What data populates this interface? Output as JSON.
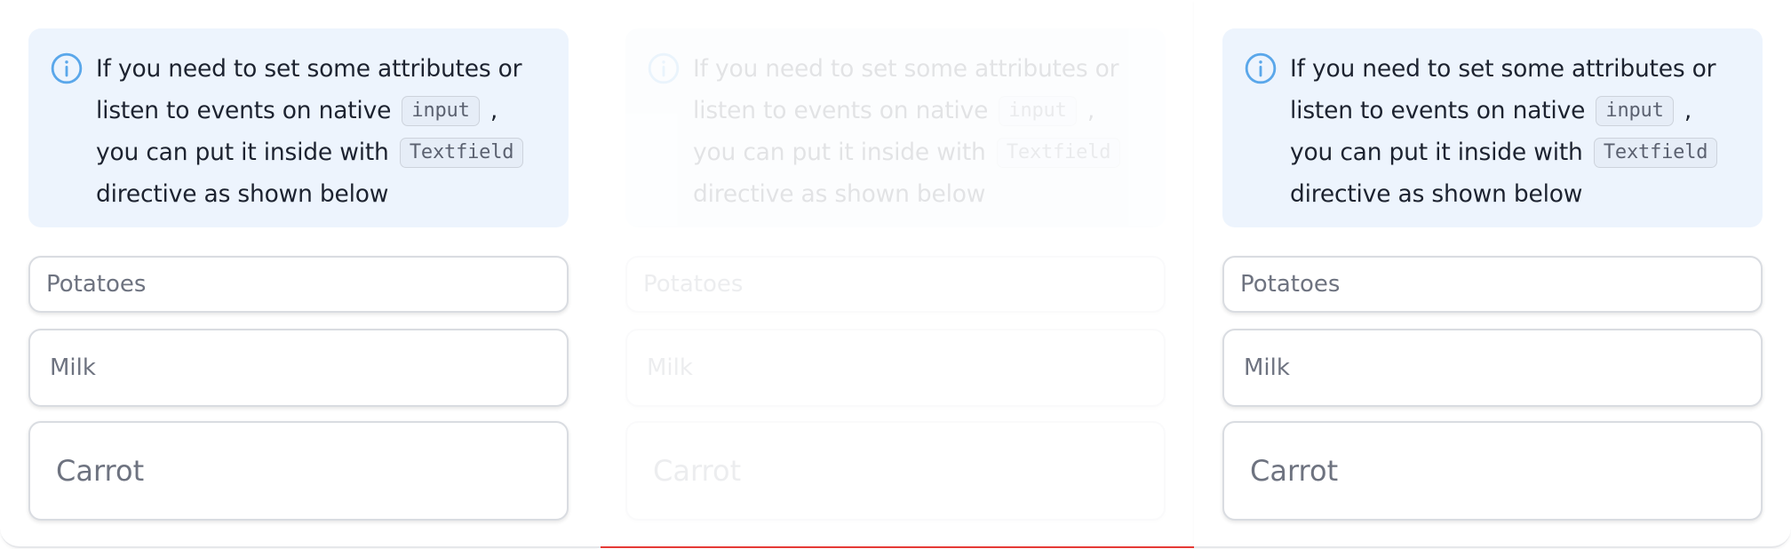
{
  "alert": {
    "text_before_input": "If you need to set some attributes or listen to events on native",
    "code_input": "input",
    "text_after_input": ", you can put it inside with",
    "code_textfield": "Textfield",
    "text_end": "directive as shown below",
    "icon": "info-circle-icon",
    "background_color": "#edf4fd",
    "icon_color": "#5aa7ea"
  },
  "fields": {
    "small_value": "Potatoes",
    "medium_value": "Milk",
    "large_value": "Carrot"
  },
  "colors": {
    "field_border": "#d9dce1",
    "field_text": "#6e7380",
    "highlight_line": "#e53935"
  }
}
